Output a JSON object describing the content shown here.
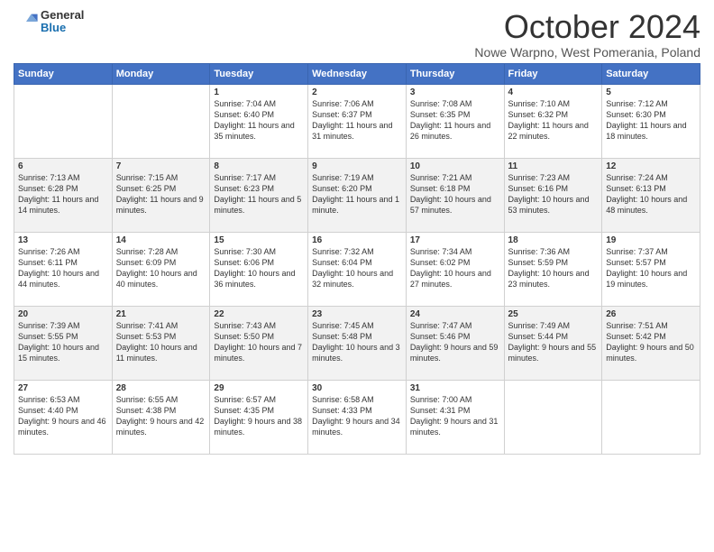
{
  "header": {
    "logo": {
      "general": "General",
      "blue": "Blue"
    },
    "title": "October 2024",
    "subtitle": "Nowe Warpno, West Pomerania, Poland"
  },
  "days_of_week": [
    "Sunday",
    "Monday",
    "Tuesday",
    "Wednesday",
    "Thursday",
    "Friday",
    "Saturday"
  ],
  "weeks": [
    [
      {
        "num": "",
        "sunrise": "",
        "sunset": "",
        "daylight": ""
      },
      {
        "num": "",
        "sunrise": "",
        "sunset": "",
        "daylight": ""
      },
      {
        "num": "1",
        "sunrise": "Sunrise: 7:04 AM",
        "sunset": "Sunset: 6:40 PM",
        "daylight": "Daylight: 11 hours and 35 minutes."
      },
      {
        "num": "2",
        "sunrise": "Sunrise: 7:06 AM",
        "sunset": "Sunset: 6:37 PM",
        "daylight": "Daylight: 11 hours and 31 minutes."
      },
      {
        "num": "3",
        "sunrise": "Sunrise: 7:08 AM",
        "sunset": "Sunset: 6:35 PM",
        "daylight": "Daylight: 11 hours and 26 minutes."
      },
      {
        "num": "4",
        "sunrise": "Sunrise: 7:10 AM",
        "sunset": "Sunset: 6:32 PM",
        "daylight": "Daylight: 11 hours and 22 minutes."
      },
      {
        "num": "5",
        "sunrise": "Sunrise: 7:12 AM",
        "sunset": "Sunset: 6:30 PM",
        "daylight": "Daylight: 11 hours and 18 minutes."
      }
    ],
    [
      {
        "num": "6",
        "sunrise": "Sunrise: 7:13 AM",
        "sunset": "Sunset: 6:28 PM",
        "daylight": "Daylight: 11 hours and 14 minutes."
      },
      {
        "num": "7",
        "sunrise": "Sunrise: 7:15 AM",
        "sunset": "Sunset: 6:25 PM",
        "daylight": "Daylight: 11 hours and 9 minutes."
      },
      {
        "num": "8",
        "sunrise": "Sunrise: 7:17 AM",
        "sunset": "Sunset: 6:23 PM",
        "daylight": "Daylight: 11 hours and 5 minutes."
      },
      {
        "num": "9",
        "sunrise": "Sunrise: 7:19 AM",
        "sunset": "Sunset: 6:20 PM",
        "daylight": "Daylight: 11 hours and 1 minute."
      },
      {
        "num": "10",
        "sunrise": "Sunrise: 7:21 AM",
        "sunset": "Sunset: 6:18 PM",
        "daylight": "Daylight: 10 hours and 57 minutes."
      },
      {
        "num": "11",
        "sunrise": "Sunrise: 7:23 AM",
        "sunset": "Sunset: 6:16 PM",
        "daylight": "Daylight: 10 hours and 53 minutes."
      },
      {
        "num": "12",
        "sunrise": "Sunrise: 7:24 AM",
        "sunset": "Sunset: 6:13 PM",
        "daylight": "Daylight: 10 hours and 48 minutes."
      }
    ],
    [
      {
        "num": "13",
        "sunrise": "Sunrise: 7:26 AM",
        "sunset": "Sunset: 6:11 PM",
        "daylight": "Daylight: 10 hours and 44 minutes."
      },
      {
        "num": "14",
        "sunrise": "Sunrise: 7:28 AM",
        "sunset": "Sunset: 6:09 PM",
        "daylight": "Daylight: 10 hours and 40 minutes."
      },
      {
        "num": "15",
        "sunrise": "Sunrise: 7:30 AM",
        "sunset": "Sunset: 6:06 PM",
        "daylight": "Daylight: 10 hours and 36 minutes."
      },
      {
        "num": "16",
        "sunrise": "Sunrise: 7:32 AM",
        "sunset": "Sunset: 6:04 PM",
        "daylight": "Daylight: 10 hours and 32 minutes."
      },
      {
        "num": "17",
        "sunrise": "Sunrise: 7:34 AM",
        "sunset": "Sunset: 6:02 PM",
        "daylight": "Daylight: 10 hours and 27 minutes."
      },
      {
        "num": "18",
        "sunrise": "Sunrise: 7:36 AM",
        "sunset": "Sunset: 5:59 PM",
        "daylight": "Daylight: 10 hours and 23 minutes."
      },
      {
        "num": "19",
        "sunrise": "Sunrise: 7:37 AM",
        "sunset": "Sunset: 5:57 PM",
        "daylight": "Daylight: 10 hours and 19 minutes."
      }
    ],
    [
      {
        "num": "20",
        "sunrise": "Sunrise: 7:39 AM",
        "sunset": "Sunset: 5:55 PM",
        "daylight": "Daylight: 10 hours and 15 minutes."
      },
      {
        "num": "21",
        "sunrise": "Sunrise: 7:41 AM",
        "sunset": "Sunset: 5:53 PM",
        "daylight": "Daylight: 10 hours and 11 minutes."
      },
      {
        "num": "22",
        "sunrise": "Sunrise: 7:43 AM",
        "sunset": "Sunset: 5:50 PM",
        "daylight": "Daylight: 10 hours and 7 minutes."
      },
      {
        "num": "23",
        "sunrise": "Sunrise: 7:45 AM",
        "sunset": "Sunset: 5:48 PM",
        "daylight": "Daylight: 10 hours and 3 minutes."
      },
      {
        "num": "24",
        "sunrise": "Sunrise: 7:47 AM",
        "sunset": "Sunset: 5:46 PM",
        "daylight": "Daylight: 9 hours and 59 minutes."
      },
      {
        "num": "25",
        "sunrise": "Sunrise: 7:49 AM",
        "sunset": "Sunset: 5:44 PM",
        "daylight": "Daylight: 9 hours and 55 minutes."
      },
      {
        "num": "26",
        "sunrise": "Sunrise: 7:51 AM",
        "sunset": "Sunset: 5:42 PM",
        "daylight": "Daylight: 9 hours and 50 minutes."
      }
    ],
    [
      {
        "num": "27",
        "sunrise": "Sunrise: 6:53 AM",
        "sunset": "Sunset: 4:40 PM",
        "daylight": "Daylight: 9 hours and 46 minutes."
      },
      {
        "num": "28",
        "sunrise": "Sunrise: 6:55 AM",
        "sunset": "Sunset: 4:38 PM",
        "daylight": "Daylight: 9 hours and 42 minutes."
      },
      {
        "num": "29",
        "sunrise": "Sunrise: 6:57 AM",
        "sunset": "Sunset: 4:35 PM",
        "daylight": "Daylight: 9 hours and 38 minutes."
      },
      {
        "num": "30",
        "sunrise": "Sunrise: 6:58 AM",
        "sunset": "Sunset: 4:33 PM",
        "daylight": "Daylight: 9 hours and 34 minutes."
      },
      {
        "num": "31",
        "sunrise": "Sunrise: 7:00 AM",
        "sunset": "Sunset: 4:31 PM",
        "daylight": "Daylight: 9 hours and 31 minutes."
      },
      {
        "num": "",
        "sunrise": "",
        "sunset": "",
        "daylight": ""
      },
      {
        "num": "",
        "sunrise": "",
        "sunset": "",
        "daylight": ""
      }
    ]
  ]
}
